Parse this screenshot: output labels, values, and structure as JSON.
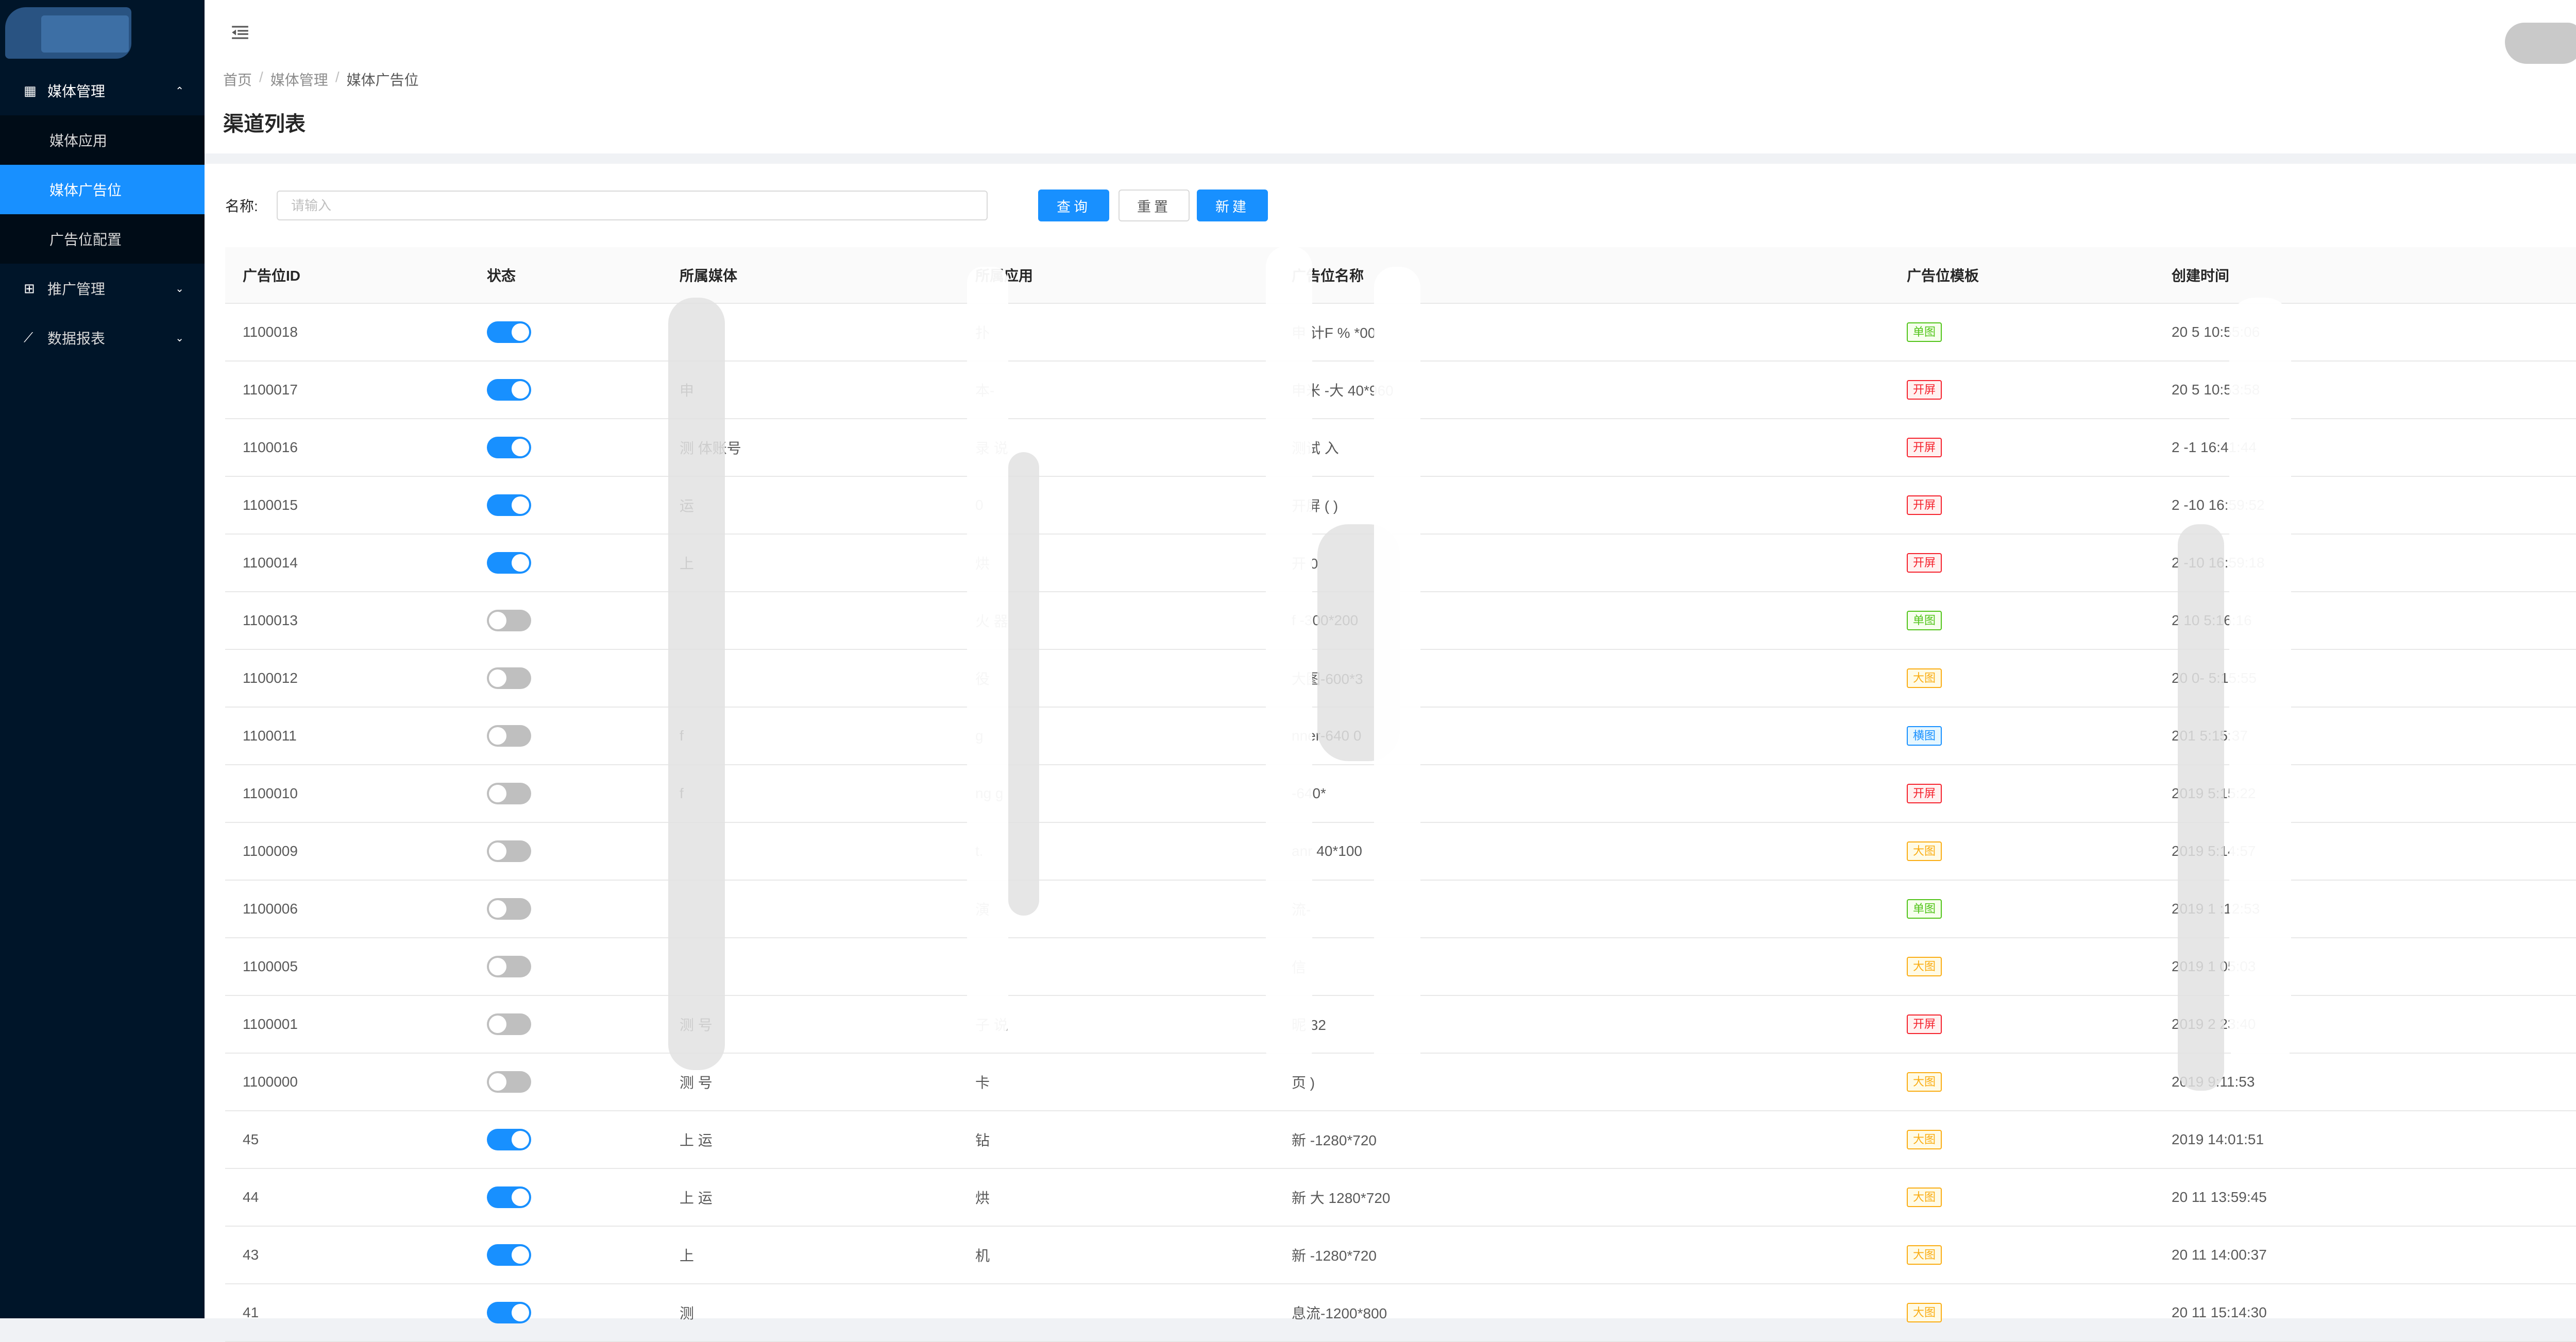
{
  "colors": {
    "sidebar_bg": "#001529",
    "submenu_bg": "#000c17",
    "primary": "#1890ff",
    "tag_single": "#52c41a",
    "tag_splash": "#f5222d",
    "tag_large": "#faad14",
    "tag_banner": "#1890ff"
  },
  "sidebar": {
    "groups": [
      {
        "label": "媒体管理",
        "icon": "grid-icon",
        "expanded": true,
        "items": [
          {
            "label": "媒体应用",
            "active": false
          },
          {
            "label": "媒体广告位",
            "active": true
          },
          {
            "label": "广告位配置",
            "active": false
          }
        ]
      },
      {
        "label": "推广管理",
        "icon": "cluster-icon",
        "expanded": false
      },
      {
        "label": "数据报表",
        "icon": "line-chart-icon",
        "expanded": false
      }
    ]
  },
  "header": {
    "fold_icon": "menu-fold-icon",
    "power_icon": "power-icon"
  },
  "breadcrumb": [
    "首页",
    "媒体管理",
    "媒体广告位"
  ],
  "page_title": "渠道列表",
  "search": {
    "label": "名称:",
    "placeholder": "请输入",
    "value": ""
  },
  "buttons": {
    "query": "查询",
    "reset": "重置",
    "new": "新建"
  },
  "table": {
    "columns": [
      "广告位ID",
      "状态",
      "所属媒体",
      "所属应用",
      "广告位名称",
      "广告位模板",
      "创建时间"
    ],
    "rows": [
      {
        "id": "1100018",
        "on": true,
        "media": "",
        "app": "扑",
        "name": "申       计F         %    *00",
        "tpl": "单图",
        "time": "20      5 10:55:06"
      },
      {
        "id": "1100017",
        "on": true,
        "media": "申",
        "app": "         本-",
        "name": "申米          -大    40*960",
        "tpl": "开屏",
        "time": "20      5 10:53:58"
      },
      {
        "id": "1100016",
        "on": true,
        "media": "测      体账号",
        "app": "    录     说",
        "name": "测试        入",
        "tpl": "开屏",
        "time": "2   -1      16:41:44"
      },
      {
        "id": "1100015",
        "on": true,
        "media": "          运",
        "app": "0",
        "name": "开屏    (      )",
        "tpl": "开屏",
        "time": "2    -10     16:59:52"
      },
      {
        "id": "1100014",
        "on": true,
        "media": "上",
        "app": "烘",
        "name": "开            0",
        "tpl": "开屏",
        "time": "2    -10     16:59:18"
      },
      {
        "id": "1100013",
        "on": false,
        "media": "",
        "app": "火     器",
        "name": "f       -300*200",
        "tpl": "单图",
        "time": "2       10     5:16:16"
      },
      {
        "id": "1100012",
        "on": false,
        "media": "",
        "app": "役",
        "name": "        大图-600*3",
        "tpl": "大图",
        "time": "20      0-     5:15:55"
      },
      {
        "id": "1100011",
        "on": false,
        "media": "f",
        "app": "     g",
        "name": "      nner-640     0",
        "tpl": "横图",
        "time": "201        5:15:37"
      },
      {
        "id": "1100010",
        "on": false,
        "media": "f",
        "app": "ng     g",
        "name": "          -640*",
        "tpl": "开屏",
        "time": "2019       5:15:22"
      },
      {
        "id": "1100009",
        "on": false,
        "media": "",
        "app": "t.",
        "name": "         anr     40*100",
        "tpl": "大图",
        "time": "2019        5:14:57"
      },
      {
        "id": "1100006",
        "on": false,
        "media": "",
        "app": "演",
        "name": "     流-",
        "tpl": "单图",
        "time": "2019      1     :12:53"
      },
      {
        "id": "1100005",
        "on": false,
        "media": "",
        "app": "",
        "name": "信",
        "tpl": "大图",
        "time": "2019      1     05:03"
      },
      {
        "id": "1100001",
        "on": false,
        "media": "测       号",
        "app": "    子     说",
        "name": "昵        32",
        "tpl": "开屏",
        "time": "2019      2     23:40"
      },
      {
        "id": "1100000",
        "on": false,
        "media": "测       号",
        "app": "  卡",
        "name": "页      )",
        "tpl": "大图",
        "time": "2019         9:11:53"
      },
      {
        "id": "45",
        "on": true,
        "media": "上       运",
        "app": "钻",
        "name": "新            -1280*720",
        "tpl": "大图",
        "time": "2019        14:01:51"
      },
      {
        "id": "44",
        "on": true,
        "media": "上       运",
        "app": "烘",
        "name": "新        大    1280*720",
        "tpl": "大图",
        "time": "20        11 13:59:45"
      },
      {
        "id": "43",
        "on": true,
        "media": "上",
        "app": "      机",
        "name": "新         -1280*720",
        "tpl": "大图",
        "time": "20        11 14:00:37"
      },
      {
        "id": "41",
        "on": true,
        "media": "测",
        "app": "",
        "name": "         息流-1200*800",
        "tpl": "大图",
        "time": "20        11 15:14:30"
      }
    ]
  }
}
